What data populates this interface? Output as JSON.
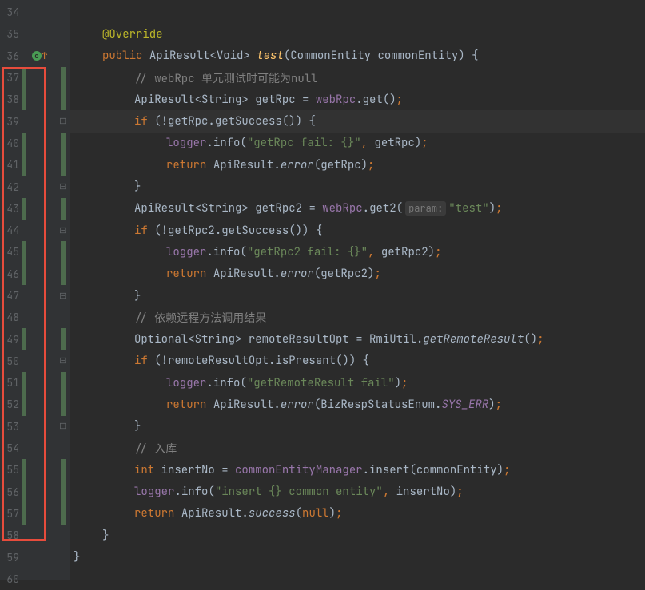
{
  "lines": {
    "l34": "34",
    "l35": "35",
    "l36": "36",
    "l37": "37",
    "l38": "38",
    "l39": "39",
    "l40": "40",
    "l41": "41",
    "l42": "42",
    "l43": "43",
    "l44": "44",
    "l45": "45",
    "l46": "46",
    "l47": "47",
    "l48": "48",
    "l49": "49",
    "l50": "50",
    "l51": "51",
    "l52": "52",
    "l53": "53",
    "l54": "54",
    "l55": "55",
    "l56": "56",
    "l57": "57",
    "l58": "58",
    "l59": "59",
    "l60": "60"
  },
  "code": {
    "anno_override": "@Override",
    "kw_public": "public",
    "kw_if": "if",
    "kw_return": "return",
    "kw_int": "int",
    "kw_null": "null",
    "type_ApiResult": "ApiResult",
    "type_Void": "Void",
    "type_String": "String",
    "type_Optional": "Optional",
    "type_RmiUtil": "RmiUtil",
    "type_BizRespStatusEnum": "BizRespStatusEnum",
    "method_test": "test",
    "type_CommonEntity": "CommonEntity",
    "param_commonEntity": "commonEntity",
    "comment_webRpc": "// webRpc 单元测试时可能为null",
    "var_getRpc": "getRpc",
    "var_getRpc2": "getRpc2",
    "field_webRpc": "webRpc",
    "method_get": "get",
    "method_get2": "get2",
    "method_getSuccess": "getSuccess",
    "field_logger": "logger",
    "method_info": "info",
    "str_getRpc_fail": "\"getRpc fail: {}\"",
    "str_getRpc2_fail": "\"getRpc2 fail: {}\"",
    "method_error": "error",
    "hint_param": "param:",
    "str_test": "\"test\"",
    "comment_remote": "// 依赖远程方法调用结果",
    "var_remoteResultOpt": "remoteResultOpt",
    "method_getRemoteResult": "getRemoteResult",
    "method_isPresent": "isPresent",
    "str_getRemoteResult_fail": "\"getRemoteResult fail\"",
    "enum_SYS_ERR": "SYS_ERR",
    "comment_insert": "// 入库",
    "var_insertNo": "insertNo",
    "field_commonEntityManager": "commonEntityManager",
    "method_insert": "insert",
    "str_insert": "\"insert {} common entity\"",
    "method_success": "success"
  }
}
